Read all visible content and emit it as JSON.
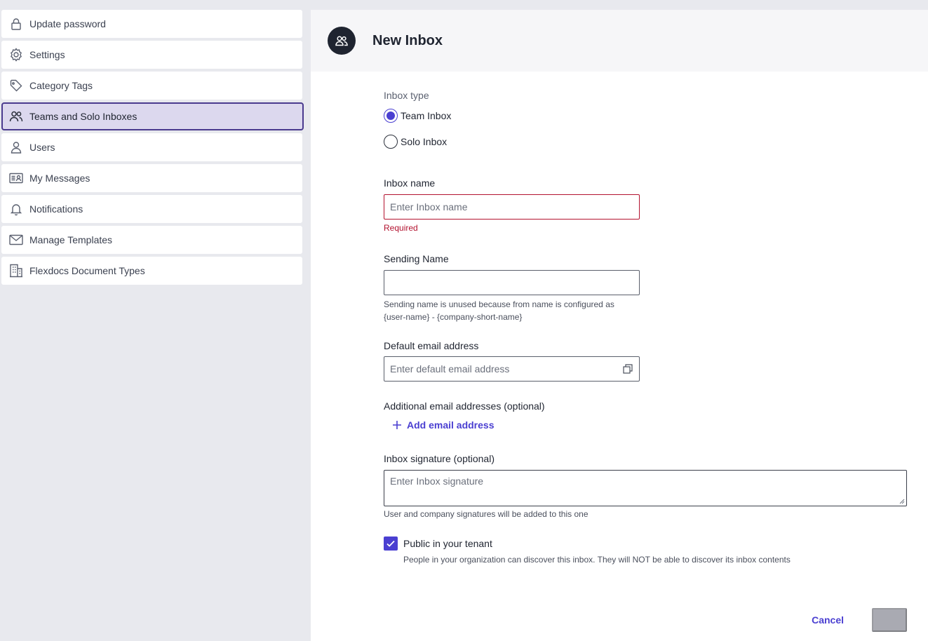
{
  "sidebar": {
    "items": [
      {
        "label": "Update password",
        "icon": "lock-icon"
      },
      {
        "label": "Settings",
        "icon": "gear-icon"
      },
      {
        "label": "Category Tags",
        "icon": "tag-icon"
      },
      {
        "label": "Teams and Solo Inboxes",
        "icon": "users-icon",
        "active": true
      },
      {
        "label": "Users",
        "icon": "user-icon"
      },
      {
        "label": "My Messages",
        "icon": "id-card-icon"
      },
      {
        "label": "Notifications",
        "icon": "bell-icon"
      },
      {
        "label": "Manage Templates",
        "icon": "envelope-icon"
      },
      {
        "label": "Flexdocs Document Types",
        "icon": "building-icon"
      }
    ]
  },
  "header": {
    "title": "New Inbox",
    "avatar_icon": "users-icon"
  },
  "form": {
    "inbox_type": {
      "label": "Inbox type",
      "options": [
        {
          "label": "Team Inbox",
          "checked": true
        },
        {
          "label": "Solo Inbox",
          "checked": false
        }
      ]
    },
    "inbox_name": {
      "label": "Inbox name",
      "placeholder": "Enter Inbox name",
      "value": "",
      "error": "Required"
    },
    "sending_name": {
      "label": "Sending Name",
      "value": "",
      "help_line1": "Sending name is unused because from name is configured as",
      "help_line2": "{user-name} - {company-short-name}"
    },
    "default_email": {
      "label": "Default email address",
      "placeholder": "Enter default email address",
      "icon": "copy-icon"
    },
    "additional_emails": {
      "label": "Additional email addresses (optional)",
      "add_label": "Add email address"
    },
    "signature": {
      "label": "Inbox signature (optional)",
      "placeholder": "Enter Inbox signature",
      "help": "User and company signatures will be added to this one"
    },
    "public": {
      "label": "Public in your tenant",
      "checked": true,
      "help": "People in your organization can discover this inbox. They will NOT be able to discover its inbox contents"
    }
  },
  "footer": {
    "cancel_label": "Cancel",
    "primary_label": ""
  },
  "colors": {
    "accent": "#4a3fd1",
    "error": "#b3122f",
    "active_nav_bg": "#dcd8ee",
    "active_nav_border": "#4a3a8e"
  }
}
